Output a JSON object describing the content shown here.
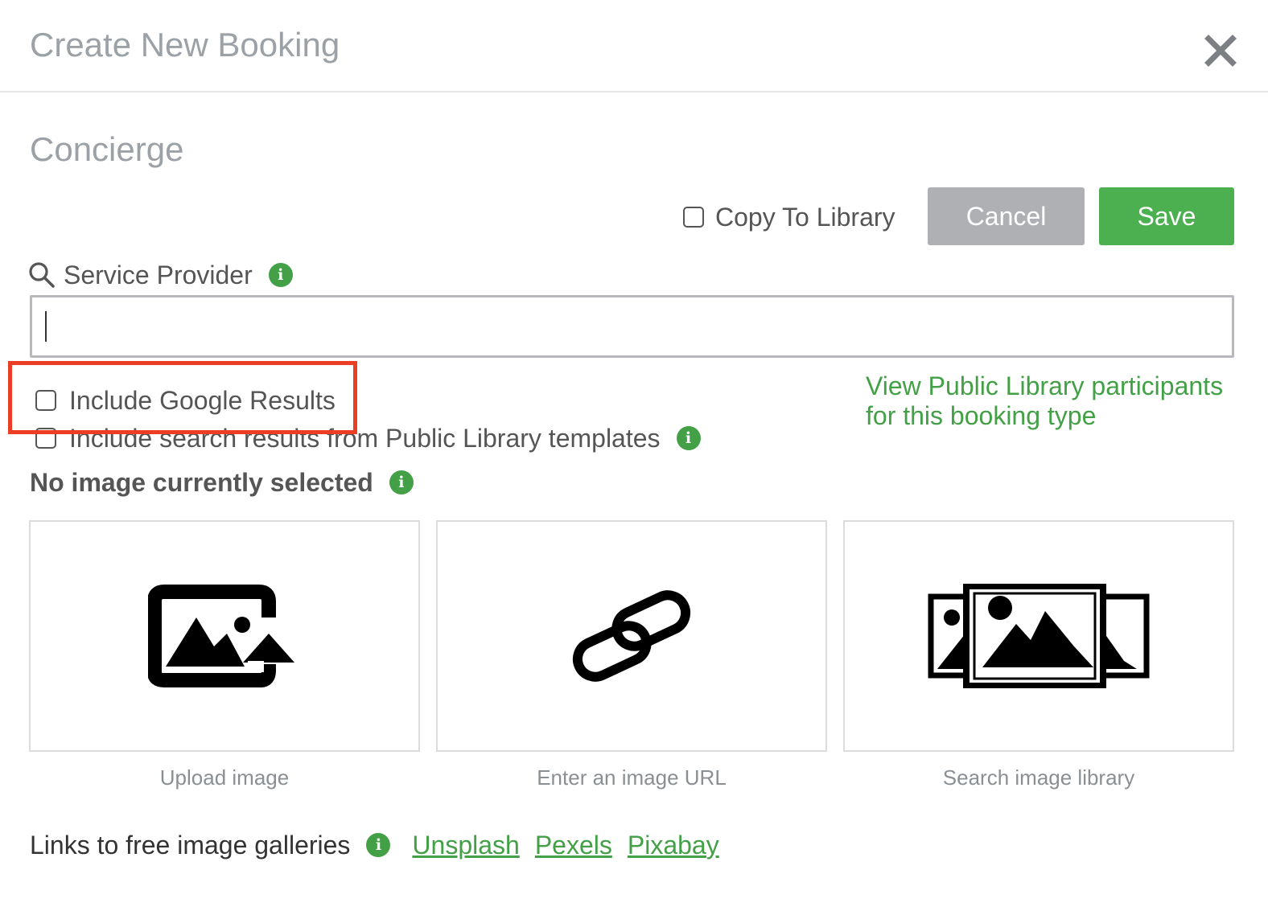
{
  "dialog": {
    "title": "Create New Booking",
    "close_icon": "close-icon"
  },
  "section": {
    "title": "Concierge"
  },
  "actions": {
    "copy_to_library": {
      "label": "Copy To Library",
      "checked": false
    },
    "cancel_label": "Cancel",
    "save_label": "Save"
  },
  "service_provider": {
    "label": "Service Provider",
    "search_icon": "search-icon",
    "info_icon": "info-icon",
    "value": "",
    "placeholder": ""
  },
  "options": {
    "include_google": {
      "label": "Include Google Results",
      "checked": false
    },
    "include_public": {
      "label": "Include search results from Public Library templates",
      "checked": false
    }
  },
  "view_public_link": "View Public Library participants for this booking type",
  "image": {
    "status": "No image currently selected",
    "cards": [
      {
        "icon": "upload-image-icon",
        "caption": "Upload image"
      },
      {
        "icon": "link-icon",
        "caption": "Enter an image URL"
      },
      {
        "icon": "image-library-icon",
        "caption": "Search image library"
      }
    ]
  },
  "galleries": {
    "label": "Links to free image galleries",
    "links": [
      "Unsplash",
      "Pexels",
      "Pixabay"
    ]
  },
  "colors": {
    "accent_green": "#43a047",
    "save_green": "#4caf50",
    "cancel_gray": "#aeb0b3",
    "highlight_red": "#ec3d25",
    "title_gray": "#9ba1a6"
  }
}
